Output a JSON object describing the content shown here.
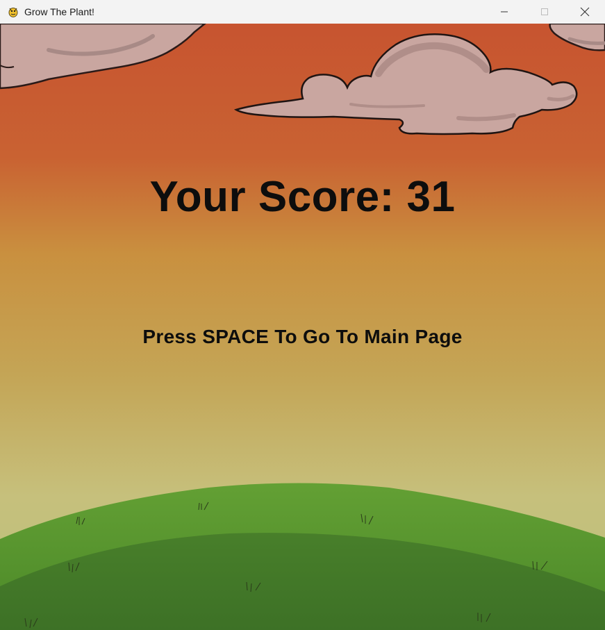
{
  "window": {
    "title": "Grow The Plant!",
    "icon": "pygame-snake-icon",
    "controls": [
      "minimize-icon",
      "maximize-icon",
      "close-icon"
    ]
  },
  "game": {
    "score_label": "Your Score: 31",
    "score": 31,
    "prompt": "Press SPACE To Go To Main Page",
    "colors": {
      "sky_top": "#c95530",
      "sky_mid": "#c98f45",
      "sky_low": "#c7c07a",
      "grass_light": "#58922c",
      "grass_dark": "#41782a",
      "cloud_fill": "#c9a6a0",
      "cloud_stroke": "#2a1a18",
      "text": "#0d0d0d"
    }
  }
}
